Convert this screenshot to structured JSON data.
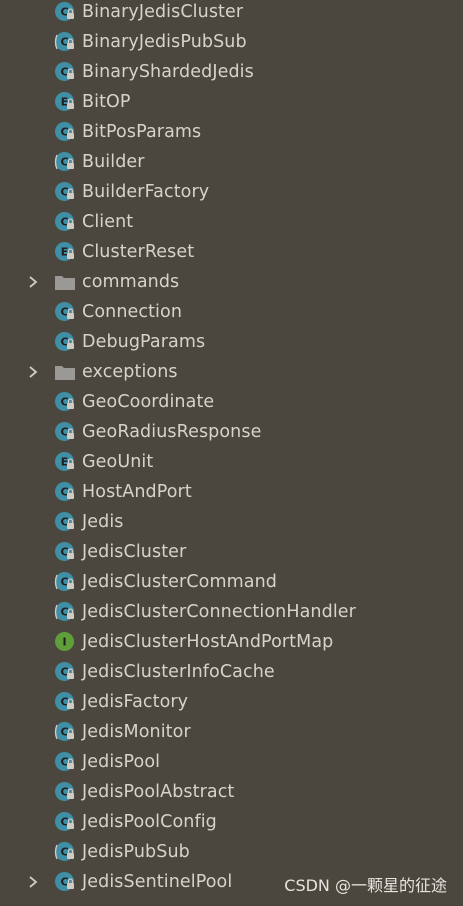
{
  "items": [
    {
      "label": "BinaryJedisCluster",
      "kind": "class-icon"
    },
    {
      "label": "BinaryJedisPubSub",
      "kind": "abstract-class-icon"
    },
    {
      "label": "BinaryShardedJedis",
      "kind": "class-icon"
    },
    {
      "label": "BitOP",
      "kind": "enum-icon"
    },
    {
      "label": "BitPosParams",
      "kind": "class-icon"
    },
    {
      "label": "Builder",
      "kind": "abstract-class-icon"
    },
    {
      "label": "BuilderFactory",
      "kind": "class-icon"
    },
    {
      "label": "Client",
      "kind": "class-icon"
    },
    {
      "label": "ClusterReset",
      "kind": "enum-icon"
    },
    {
      "label": "commands",
      "kind": "folder-icon"
    },
    {
      "label": "Connection",
      "kind": "class-icon"
    },
    {
      "label": "DebugParams",
      "kind": "class-icon"
    },
    {
      "label": "exceptions",
      "kind": "folder-icon"
    },
    {
      "label": "GeoCoordinate",
      "kind": "class-icon"
    },
    {
      "label": "GeoRadiusResponse",
      "kind": "class-icon"
    },
    {
      "label": "GeoUnit",
      "kind": "enum-icon"
    },
    {
      "label": "HostAndPort",
      "kind": "class-icon"
    },
    {
      "label": "Jedis",
      "kind": "class-icon"
    },
    {
      "label": "JedisCluster",
      "kind": "class-icon"
    },
    {
      "label": "JedisClusterCommand",
      "kind": "abstract-class-icon"
    },
    {
      "label": "JedisClusterConnectionHandler",
      "kind": "abstract-class-icon"
    },
    {
      "label": "JedisClusterHostAndPortMap",
      "kind": "interface-icon"
    },
    {
      "label": "JedisClusterInfoCache",
      "kind": "class-icon"
    },
    {
      "label": "JedisFactory",
      "kind": "class-icon"
    },
    {
      "label": "JedisMonitor",
      "kind": "abstract-class-icon"
    },
    {
      "label": "JedisPool",
      "kind": "class-icon"
    },
    {
      "label": "JedisPoolAbstract",
      "kind": "class-icon"
    },
    {
      "label": "JedisPoolConfig",
      "kind": "class-icon"
    },
    {
      "label": "JedisPubSub",
      "kind": "abstract-class-icon"
    },
    {
      "label": "JedisSentinelPool",
      "kind": "class-icon"
    }
  ],
  "expandable_labels": [
    "commands",
    "exceptions",
    "JedisSentinelPool"
  ],
  "watermark": "CSDN @一颗星的征途",
  "colors": {
    "background": "#4b473e",
    "text": "#d6d3cc",
    "class_icon": "#3f8fa6",
    "interface_icon": "#5f9e3a",
    "folder_icon": "#9a9996"
  }
}
